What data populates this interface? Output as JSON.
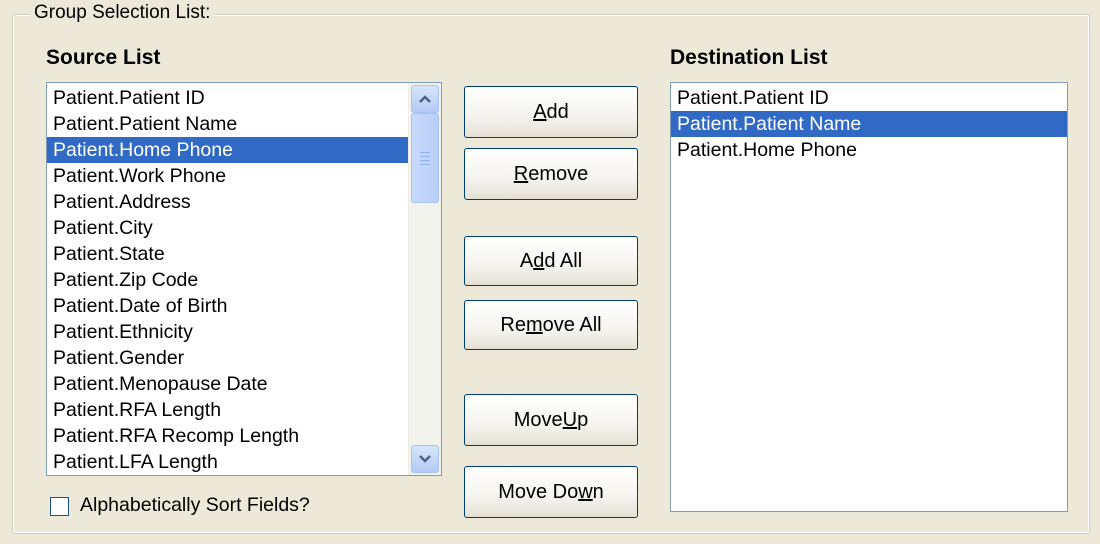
{
  "group": {
    "title": "Group Selection List:"
  },
  "source": {
    "heading": "Source List",
    "items": [
      "Patient.Patient ID",
      "Patient.Patient Name",
      "Patient.Home Phone",
      "Patient.Work Phone",
      "Patient.Address",
      "Patient.City",
      "Patient.State",
      "Patient.Zip Code",
      "Patient.Date of Birth",
      "Patient.Ethnicity",
      "Patient.Gender",
      "Patient.Menopause Date",
      "Patient.RFA Length",
      "Patient.RFA Recomp Length",
      "Patient.LFA Length"
    ],
    "selected_index": 2
  },
  "destination": {
    "heading": "Destination List",
    "items": [
      "Patient.Patient ID",
      "Patient.Patient Name",
      "Patient.Home Phone"
    ],
    "selected_index": 1
  },
  "buttons": {
    "add": {
      "label": "Add",
      "mnemonic": "A"
    },
    "remove": {
      "label": "Remove",
      "mnemonic": "R"
    },
    "add_all": {
      "label": "Add All",
      "mnemonic": "d"
    },
    "remove_all": {
      "label": "Remove All",
      "mnemonic": "m"
    },
    "move_up": {
      "label": "Move Up",
      "mnemonic": "U"
    },
    "move_down": {
      "label": "Move Down",
      "mnemonic": "w"
    }
  },
  "sort_checkbox": {
    "label": "Alphabetically Sort Fields?",
    "checked": false
  },
  "colors": {
    "selection": "#316ac5",
    "face": "#ece9d8",
    "button_border": "#003c74"
  },
  "icons": {
    "scroll_up": "chevron-up-icon",
    "scroll_down": "chevron-down-icon"
  }
}
